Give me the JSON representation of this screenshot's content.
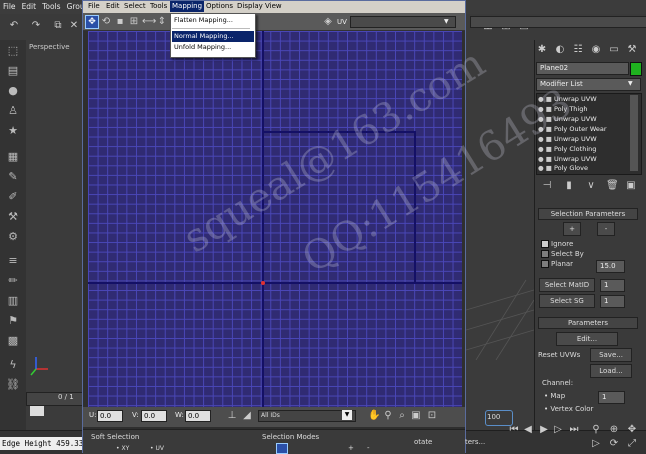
{
  "host": {
    "menubar": [
      "File",
      "Edit",
      "Tools",
      "Group"
    ],
    "viewport_label": "Perspective",
    "time_slider": "0 / 1",
    "edge_height": "Edge Height 459.33",
    "frame_number": "100"
  },
  "uvw": {
    "menus": [
      "File",
      "Edit",
      "Select",
      "Tools",
      "Mapping",
      "Options",
      "Display",
      "View"
    ],
    "active_menu": "Mapping",
    "toolbar_mode": "UV",
    "mapping_menu": [
      "Flatten Mapping...",
      "Normal Mapping...",
      "Unfold Mapping..."
    ],
    "highlighted_item": "Normal Mapping...",
    "bottom": {
      "u_label": "U:",
      "u_value": "0.0",
      "v_label": "V:",
      "v_value": "0.0",
      "w_label": "W:",
      "w_value": "0.0",
      "ids_dropdown": "All IDs"
    },
    "soft_selection": "Soft Selection",
    "xy": "XY",
    "uv": "UV",
    "selection_modes": "Selection Modes",
    "rotate": "otate",
    "ters": "ters..."
  },
  "panel": {
    "object_name": "Plane02",
    "object_color": "#1fb21f",
    "modifier_list": "Modifier List",
    "stack": [
      "Unwrap UVW",
      "Poly Thigh",
      "Unwrap UVW",
      "Poly Outer Wear",
      "Unwrap UVW",
      "Poly Clothing",
      "Unwrap UVW",
      "Poly Glove"
    ],
    "selection_parameters": "Selection Parameters",
    "plus": "+",
    "minus": "-",
    "ignore": "Ignore",
    "select_by": "Select By",
    "planar": "Planar",
    "planar_value": "15.0",
    "select_matid": "Select MatID",
    "matid_value": "1",
    "select_sg": "Select SG",
    "sg_value": "1",
    "parameters": "Parameters",
    "edit": "Edit...",
    "reset_uvws": "Reset UVWs",
    "save": "Save...",
    "load": "Load...",
    "channel": "Channel:",
    "map": "Map",
    "map_value": "1",
    "vertex_color": "Vertex Color"
  },
  "watermark": [
    "squeal@163.com",
    "QQ:115416493"
  ],
  "colors": {
    "uv_bg": "#302b73",
    "uv_grid": "#4a47b8",
    "menu_highlight": "#0a246a"
  }
}
